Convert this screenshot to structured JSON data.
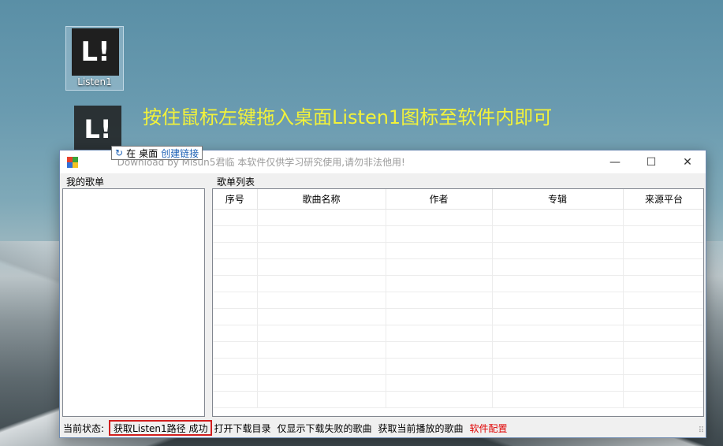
{
  "desktop": {
    "icon_label": "Listen1",
    "icon_glyph": "L!",
    "instruction": "按住鼠标左键拖入桌面Listen1图标至软件内即可",
    "drop_tip": {
      "arrow": "↻",
      "move": "在",
      "target": "桌面",
      "action": "创建链接"
    }
  },
  "window": {
    "title_prefix": "Listen1",
    "title_rest": "Download  by  Misun5君临  本软件仅供学习研究使用,请勿非法他用!",
    "controls": {
      "minimize": "—",
      "maximize": "☐",
      "close": "✕"
    }
  },
  "panels": {
    "my_playlists": "我的歌单",
    "playlist_list": "歌单列表"
  },
  "table": {
    "columns": [
      "序号",
      "歌曲名称",
      "作者",
      "专辑",
      "来源平台"
    ],
    "rows": []
  },
  "status": {
    "label": "当前状态:",
    "message": "获取Listen1路径 成功",
    "open_dir": "打开下载目录",
    "show_failed": "仅显示下载失败的歌曲",
    "get_playing": "获取当前播放的歌曲",
    "config": "软件配置"
  },
  "colors": {
    "instruction": "#f2f23a",
    "status_error_border": "#d21e1e",
    "config_link": "#e00000"
  }
}
